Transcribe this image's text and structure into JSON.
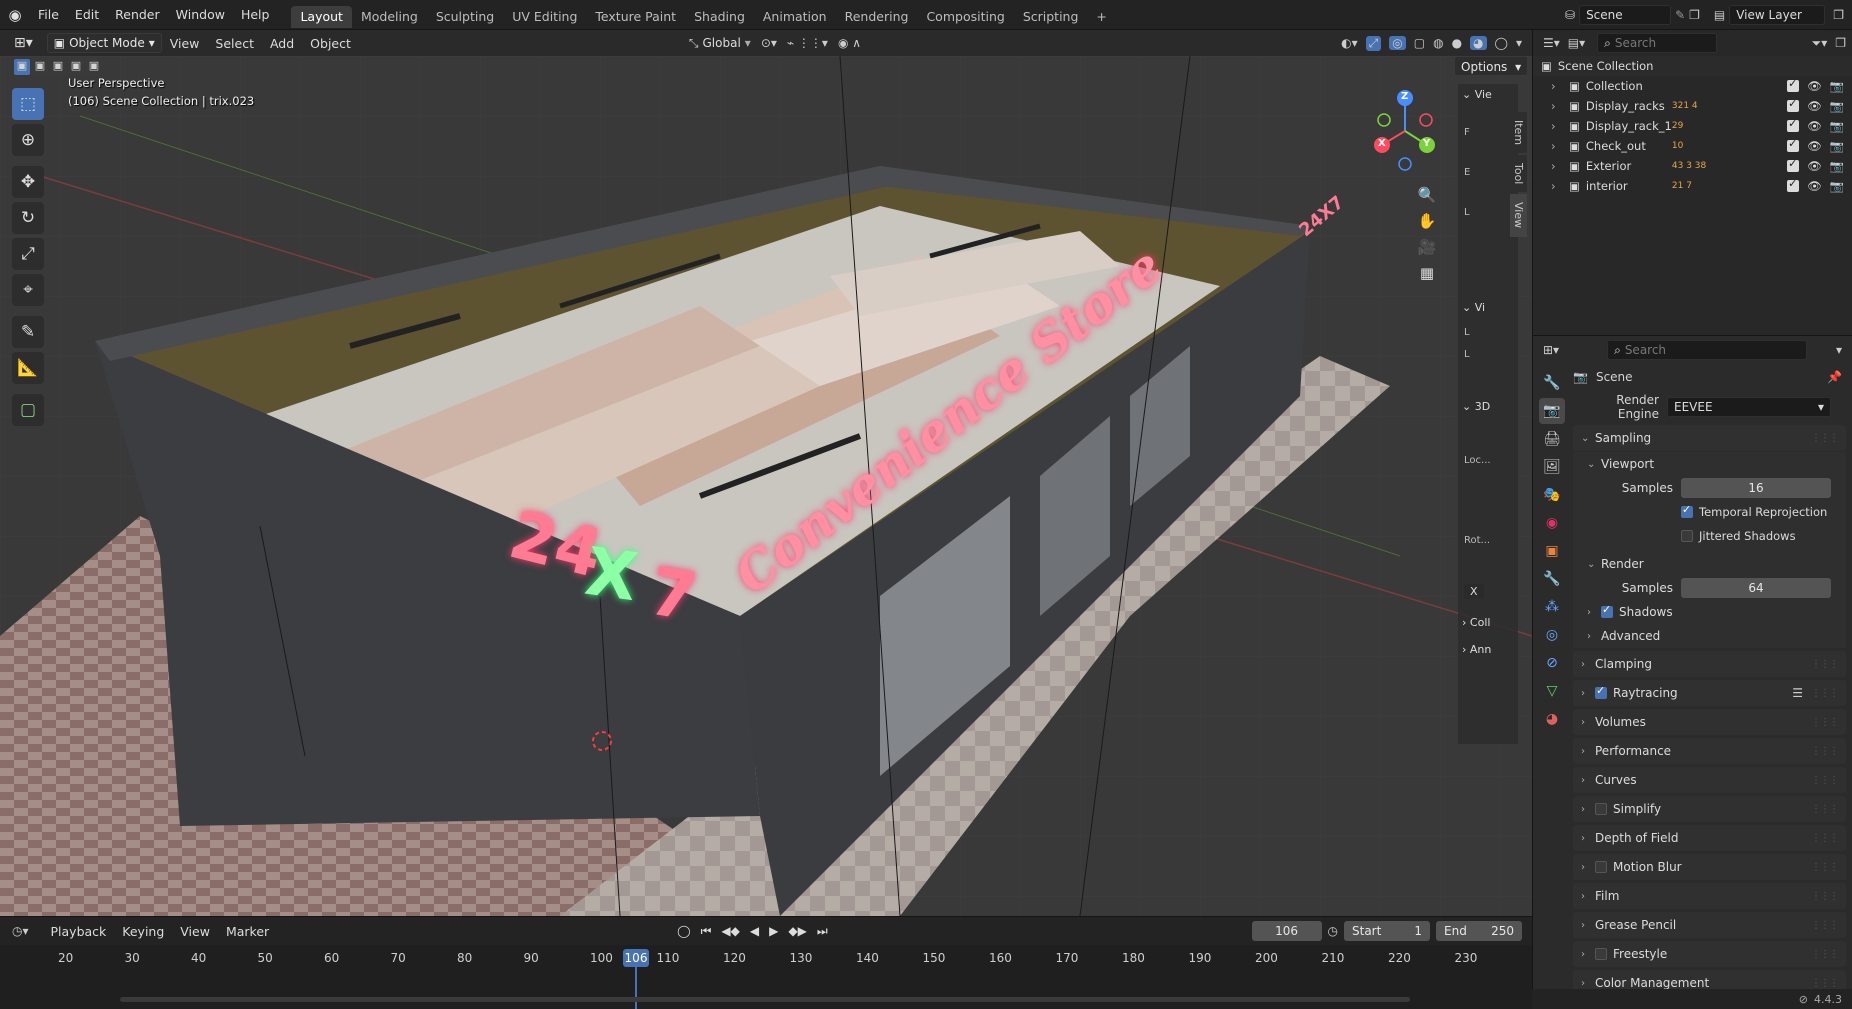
{
  "topbar": {
    "menus": [
      "File",
      "Edit",
      "Render",
      "Window",
      "Help"
    ],
    "workspaces": [
      "Layout",
      "Modeling",
      "Sculpting",
      "UV Editing",
      "Texture Paint",
      "Shading",
      "Animation",
      "Rendering",
      "Compositing",
      "Scripting"
    ],
    "active_workspace": "Layout",
    "add_tab": "+",
    "scene_name": "Scene",
    "view_layer": "View Layer"
  },
  "viewport": {
    "mode": "Object Mode",
    "menus": [
      "View",
      "Select",
      "Add",
      "Object"
    ],
    "orientation": "Global",
    "options_label": "Options",
    "overlay_line1": "User Perspective",
    "overlay_line2": "(106) Scene Collection | trix.023",
    "gizmo": {
      "x": "X",
      "y": "Y",
      "z": "Z"
    },
    "sign_24": "24",
    "sign_x": "X",
    "sign_7": "7",
    "sign_store": "Convenience Store",
    "sign_small": "24X7"
  },
  "npanel": {
    "tabs": [
      "Item",
      "Tool",
      "View"
    ],
    "sections": [
      "Vie",
      "Vi",
      "3D",
      "Coll",
      "Ann"
    ],
    "labels": [
      "F",
      "E",
      "L",
      "L",
      "L",
      "Loc...",
      "Rot...",
      "X"
    ]
  },
  "timeline": {
    "menus": [
      "Playback",
      "Keying",
      "View",
      "Marker"
    ],
    "current_frame": "106",
    "start_label": "Start",
    "start": "1",
    "end_label": "End",
    "end": "250",
    "ticks": [
      "20",
      "30",
      "40",
      "50",
      "60",
      "70",
      "80",
      "90",
      "100",
      "110",
      "120",
      "130",
      "140",
      "150",
      "160",
      "170",
      "180",
      "190",
      "200",
      "210",
      "220",
      "230"
    ]
  },
  "outliner": {
    "search_placeholder": "Search",
    "root": "Scene Collection",
    "items": [
      {
        "name": "Collection",
        "badges": ""
      },
      {
        "name": "Display_racks",
        "badges": "321 4"
      },
      {
        "name": "Display_rack_1",
        "badges": "29"
      },
      {
        "name": "Check_out",
        "badges": "10"
      },
      {
        "name": "Exterior",
        "badges": "43 3 38"
      },
      {
        "name": "interior",
        "badges": "21 7"
      }
    ]
  },
  "properties": {
    "search_placeholder": "Search",
    "context": "Scene",
    "render_engine_label": "Render Engine",
    "render_engine": "EEVEE",
    "sampling": "Sampling",
    "viewport": "Viewport",
    "samples_label": "Samples",
    "viewport_samples": "16",
    "temporal_reprojection": "Temporal Reprojection",
    "jittered_shadows": "Jittered Shadows",
    "render": "Render",
    "render_samples": "64",
    "shadows": "Shadows",
    "advanced": "Advanced",
    "sections": [
      "Clamping",
      "Raytracing",
      "Volumes",
      "Performance",
      "Curves",
      "Simplify",
      "Depth of Field",
      "Motion Blur",
      "Film",
      "Grease Pencil",
      "Freestyle",
      "Color Management"
    ]
  },
  "status": {
    "version": "4.4.3"
  },
  "colors": {
    "accent": "#4772b3",
    "neon_pink": "#ff6b8a",
    "neon_green": "#7dff9a"
  }
}
